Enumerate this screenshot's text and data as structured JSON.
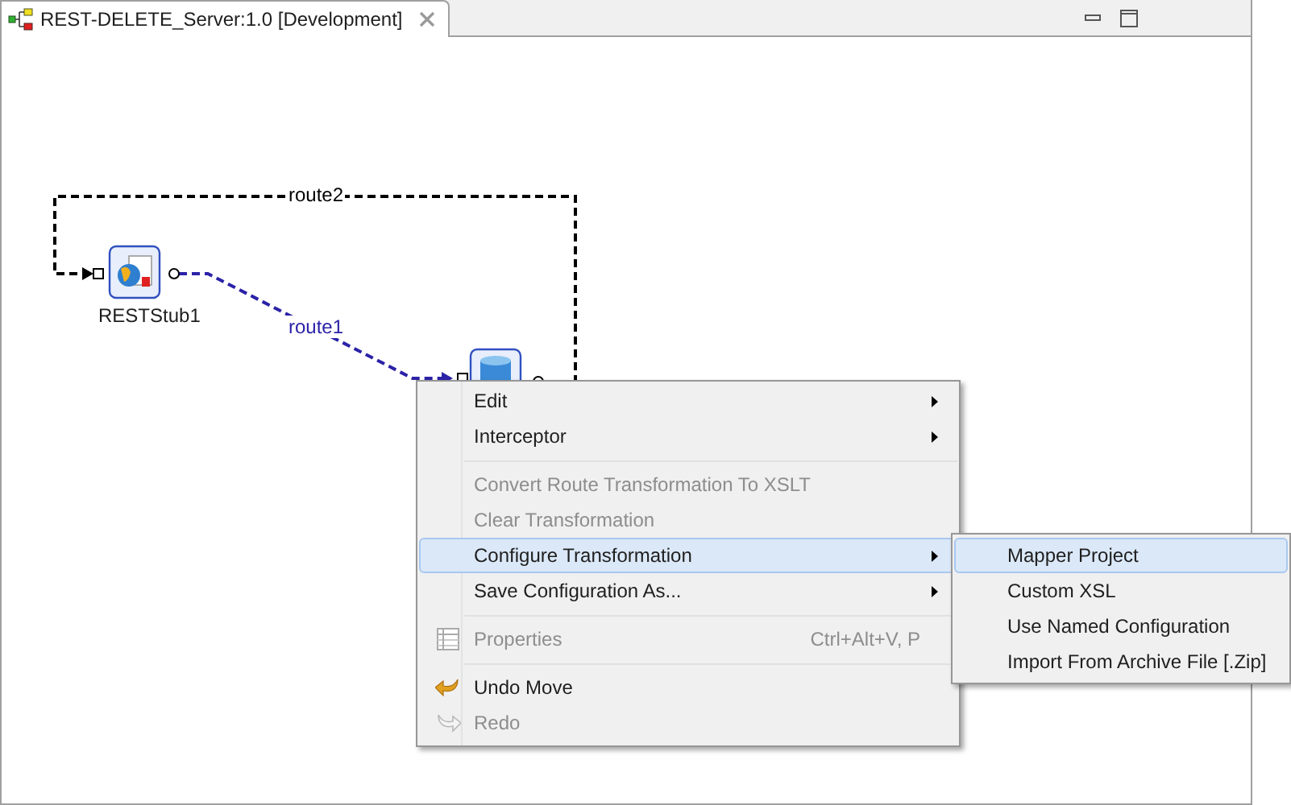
{
  "editor_tab": {
    "title": "REST-DELETE_Server:1.0 [Development]",
    "selected": true
  },
  "canvas": {
    "nodes": [
      {
        "kind": "rest",
        "label": "RESTStub1"
      },
      {
        "kind": "database"
      }
    ],
    "routes": [
      {
        "label": "route2",
        "color": "#000000"
      },
      {
        "label": "route1",
        "color": "#2b22a8"
      }
    ]
  },
  "context_menu": {
    "items": [
      {
        "kind": "plain",
        "label": "Edit",
        "disabled": false,
        "selected": false,
        "submenu": true
      },
      {
        "kind": "plain",
        "label": "Interceptor",
        "disabled": false,
        "selected": false,
        "submenu": true
      },
      {
        "kind": "separator"
      },
      {
        "kind": "plain",
        "label": "Convert Route Transformation To XSLT",
        "disabled": true,
        "selected": false,
        "submenu": false
      },
      {
        "kind": "plain",
        "label": "Clear Transformation",
        "disabled": true,
        "selected": false,
        "submenu": false
      },
      {
        "kind": "plain",
        "label": "Configure Transformation",
        "disabled": false,
        "selected": true,
        "submenu": true
      },
      {
        "kind": "plain",
        "label": "Save Configuration As...",
        "disabled": false,
        "selected": false,
        "submenu": true
      },
      {
        "kind": "separator"
      },
      {
        "kind": "table",
        "label": "Properties",
        "shortcut": "Ctrl+Alt+V, P",
        "disabled": true,
        "selected": false,
        "submenu": false
      },
      {
        "kind": "separator"
      },
      {
        "kind": "undo",
        "label": "Undo Move",
        "disabled": false,
        "selected": false,
        "submenu": false
      },
      {
        "kind": "redo",
        "label": "Redo",
        "disabled": true,
        "selected": false,
        "submenu": false
      }
    ]
  },
  "submenu": {
    "items": [
      {
        "label": "Mapper Project",
        "selected": true
      },
      {
        "label": "Custom XSL",
        "selected": false
      },
      {
        "label": "Use Named Configuration",
        "selected": false
      },
      {
        "label": "Import From Archive File [.Zip]",
        "selected": false
      }
    ]
  }
}
